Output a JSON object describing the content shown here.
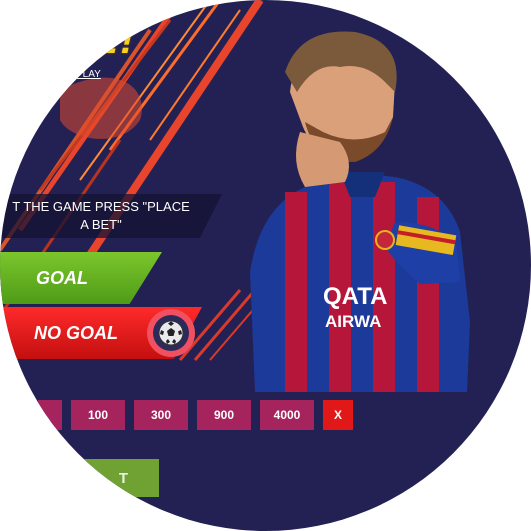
{
  "headline": {
    "text": "E!"
  },
  "how_to_play": {
    "text": "PLAY"
  },
  "instruction": {
    "text": "T THE GAME PRESS \"PLACE A BET\""
  },
  "buttons": {
    "goal": "GOAL",
    "no_goal": "NO GOAL",
    "place_bet": "T"
  },
  "chips": [
    "",
    "100",
    "300",
    "900",
    "4000"
  ],
  "clear_label": "X",
  "jersey": {
    "sponsor_line1": "QATA",
    "sponsor_line2": "AIRWA"
  },
  "colors": {
    "background": "#232154",
    "goal": "#5fae1f",
    "no_goal": "#e51b1b",
    "chip": "#a5245e",
    "clear": "#e01818",
    "place_bet": "#6fa232",
    "headline": "#f6d21a"
  }
}
